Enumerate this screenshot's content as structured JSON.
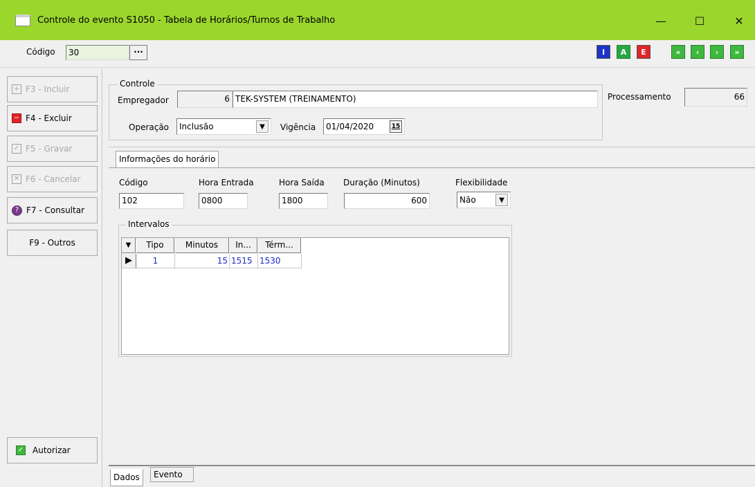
{
  "window": {
    "title": "Controle do evento S1050 - Tabela de Horários/Turnos de Trabalho",
    "minimize": "—",
    "maximize": "☐",
    "close": "✕"
  },
  "topbar": {
    "codigo_label": "Código",
    "codigo_value": "30",
    "lookup_label": "···",
    "mode_buttons": [
      "I",
      "A",
      "E"
    ],
    "nav_buttons": [
      "«",
      "‹",
      "›",
      "»"
    ]
  },
  "sidebar": {
    "items": [
      {
        "label": "F3 - Incluir",
        "icon": "plus-icon",
        "enabled": false
      },
      {
        "label": "F4 - Excluir",
        "icon": "minus-icon",
        "enabled": true
      },
      {
        "label": "F5 - Gravar",
        "icon": "check-icon",
        "enabled": false
      },
      {
        "label": "F6 - Cancelar",
        "icon": "x-icon",
        "enabled": false
      },
      {
        "label": "F7 - Consultar",
        "icon": "question-icon",
        "enabled": true
      },
      {
        "label": "F9 - Outros",
        "icon": "",
        "enabled": true
      }
    ],
    "autorizar_label": "Autorizar"
  },
  "controle": {
    "title": "Controle",
    "empregador_label": "Empregador",
    "empregador_code": "6",
    "empregador_name": "TEK-SYSTEM (TREINAMENTO)",
    "processamento_label": "Processamento",
    "processamento_value": "66",
    "operacao_label": "Operação",
    "operacao_value": "Inclusão",
    "vigencia_label": "Vigência",
    "vigencia_value": "01/04/2020",
    "calendar_label": "15"
  },
  "horario": {
    "tab_label": "Informações do horário",
    "codigo_label": "Código",
    "codigo_value": "102",
    "hora_entrada_label": "Hora Entrada",
    "hora_entrada_value": "0800",
    "hora_saida_label": "Hora Saída",
    "hora_saida_value": "1800",
    "duracao_label": "Duração (Minutos)",
    "duracao_value": "600",
    "flexibilidade_label": "Flexibilidade",
    "flexibilidade_value": "Não"
  },
  "intervalos": {
    "title": "Intervalos",
    "columns": [
      "Tipo",
      "Minutos",
      "In...",
      "Térm..."
    ],
    "rows": [
      {
        "tipo": "1",
        "minutos": "15",
        "inicio": "1515",
        "termino": "1530"
      }
    ]
  },
  "bottom_tabs": [
    "Dados",
    "Evento"
  ]
}
